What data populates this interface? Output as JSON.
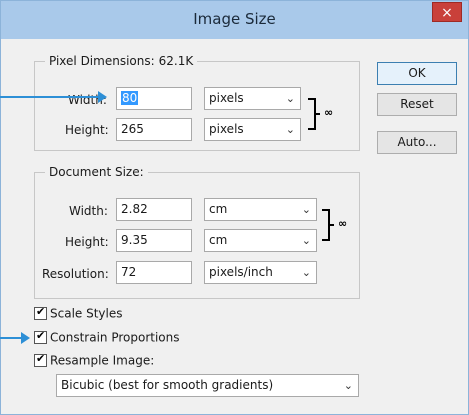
{
  "window": {
    "title": "Image Size",
    "close_glyph": "×"
  },
  "pixel_dimensions": {
    "legend_label": "Pixel Dimensions:",
    "size": "62.1K",
    "width_label": "Width:",
    "width_value": "80",
    "width_unit": "pixels",
    "height_label": "Height:",
    "height_value": "265",
    "height_unit": "pixels"
  },
  "document_size": {
    "legend_label": "Document Size:",
    "width_label": "Width:",
    "width_value": "2.82",
    "width_unit": "cm",
    "height_label": "Height:",
    "height_value": "9.35",
    "height_unit": "cm",
    "resolution_label": "Resolution:",
    "resolution_value": "72",
    "resolution_unit": "pixels/inch"
  },
  "buttons": {
    "ok": "OK",
    "reset": "Reset",
    "auto": "Auto..."
  },
  "options": {
    "scale_styles": {
      "label": "Scale Styles",
      "checked": true
    },
    "constrain_proportions": {
      "label": "Constrain Proportions",
      "checked": true
    },
    "resample_image": {
      "label": "Resample Image:",
      "checked": true
    },
    "resample_method": "Bicubic (best for smooth gradients)"
  },
  "colors": {
    "titlebar": "#a9c9ea",
    "close": "#c9403a",
    "pointer_arrow": "#2d8fd6"
  },
  "icons": {
    "dropdown": "chevron-down-icon",
    "link": "chain-link-icon",
    "check": "checkmark-icon"
  }
}
